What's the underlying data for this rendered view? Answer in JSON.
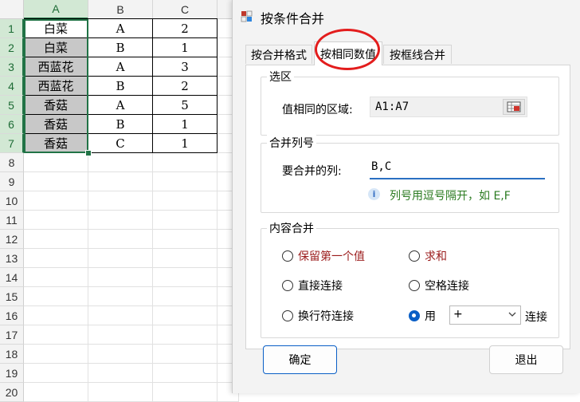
{
  "sheet": {
    "columns": [
      "A",
      "B",
      "C"
    ],
    "rows": [
      "1",
      "2",
      "3",
      "4",
      "5",
      "6",
      "7",
      "8",
      "9",
      "10",
      "11",
      "12",
      "13",
      "14",
      "15",
      "16",
      "17",
      "18",
      "19",
      "20"
    ],
    "data": [
      [
        "白菜",
        "A",
        "2"
      ],
      [
        "白菜",
        "B",
        "1"
      ],
      [
        "西蓝花",
        "A",
        "3"
      ],
      [
        "西蓝花",
        "B",
        "2"
      ],
      [
        "香菇",
        "A",
        "5"
      ],
      [
        "香菇",
        "B",
        "1"
      ],
      [
        "香菇",
        "C",
        "1"
      ]
    ]
  },
  "dialog": {
    "title": "按条件合并",
    "tabs": [
      {
        "label": "按合并格式",
        "active": false
      },
      {
        "label": "按相同数值",
        "active": true
      },
      {
        "label": "按框线合并",
        "active": false
      }
    ],
    "selection_group": {
      "legend": "选区",
      "range_label": "值相同的区域:",
      "range_value": "A1:A7"
    },
    "merge_columns_group": {
      "legend": "合并列号",
      "columns_label": "要合并的列:",
      "columns_value": "B,C",
      "hint": "列号用逗号隔开，如 E,F"
    },
    "content_group": {
      "legend": "内容合并",
      "options": {
        "keep_first": "保留第一个值",
        "sum": "求和",
        "direct_concat": "直接连接",
        "space_concat": "空格连接",
        "newline_concat": "换行符连接",
        "use_label": "用",
        "use_value": "+",
        "concat_suffix": "连接"
      },
      "selected": "use"
    },
    "ok_button": "确定",
    "exit_button": "退出"
  }
}
